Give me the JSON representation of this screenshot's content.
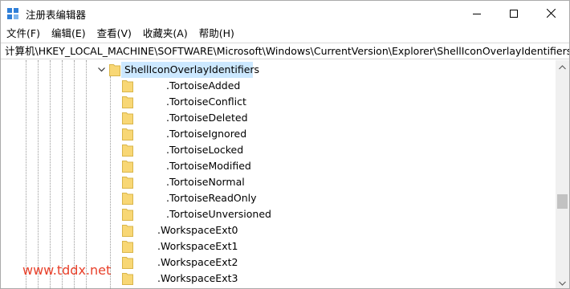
{
  "window": {
    "title": "注册表编辑器",
    "icon": "regedit-icon"
  },
  "menu": [
    {
      "label": "文件(F)"
    },
    {
      "label": "编辑(E)"
    },
    {
      "label": "查看(V)"
    },
    {
      "label": "收藏夹(A)"
    },
    {
      "label": "帮助(H)"
    }
  ],
  "address": "计算机\\HKEY_LOCAL_MACHINE\\SOFTWARE\\Microsoft\\Windows\\CurrentVersion\\Explorer\\ShellIconOverlayIdentifiers",
  "tree": {
    "selected": "ShellIconOverlayIdentifiers",
    "children": [
      ".TortoiseAdded",
      ".TortoiseConflict",
      ".TortoiseDeleted",
      ".TortoiseIgnored",
      ".TortoiseLocked",
      ".TortoiseModified",
      ".TortoiseNormal",
      ".TortoiseReadOnly",
      ".TortoiseUnversioned",
      ".WorkspaceExt0",
      ".WorkspaceExt1",
      ".WorkspaceExt2",
      ".WorkspaceExt3"
    ]
  },
  "watermark": "www.tddx.net",
  "colors": {
    "selection": "#cce8ff",
    "folder": "#f8d775",
    "watermark": "#e8402a"
  }
}
